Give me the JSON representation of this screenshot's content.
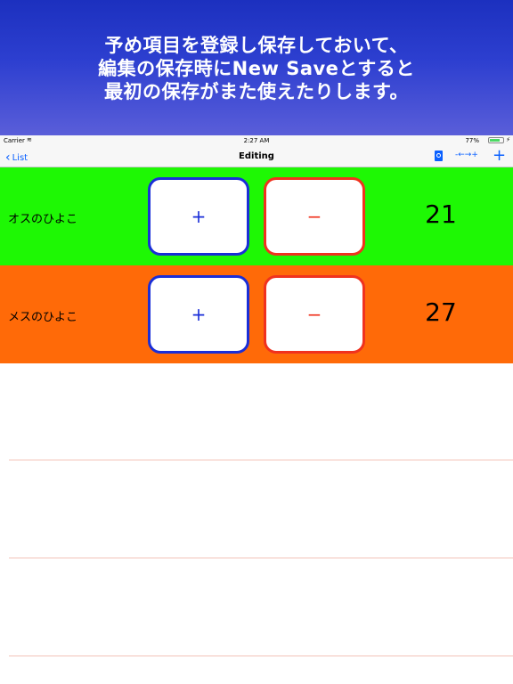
{
  "banner": {
    "lines": [
      "予め項目を登録し保存しておいて、",
      "編集の保存時にNew Saveとすると",
      "最初の保存がまた使えたりします。"
    ]
  },
  "statusbar": {
    "carrier": "Carrier",
    "time": "2:27 AM",
    "battery": "77%",
    "battery_level": 0.77
  },
  "navbar": {
    "back_label": "List",
    "title": "Editing",
    "step_label": "-←→+",
    "add_label": "+"
  },
  "rows": [
    {
      "label": "オスのひよこ",
      "count": "21",
      "color": "#1ef804",
      "plus": "+",
      "minus": "−"
    },
    {
      "label": "メスのひよこ",
      "count": "27",
      "color": "#ff6a08",
      "plus": "+",
      "minus": "−"
    }
  ],
  "colors": {
    "accent": "#0a60ff",
    "plus_border": "#1a2ed8",
    "minus_border": "#f0321e",
    "separator": "#f3c3b8"
  }
}
